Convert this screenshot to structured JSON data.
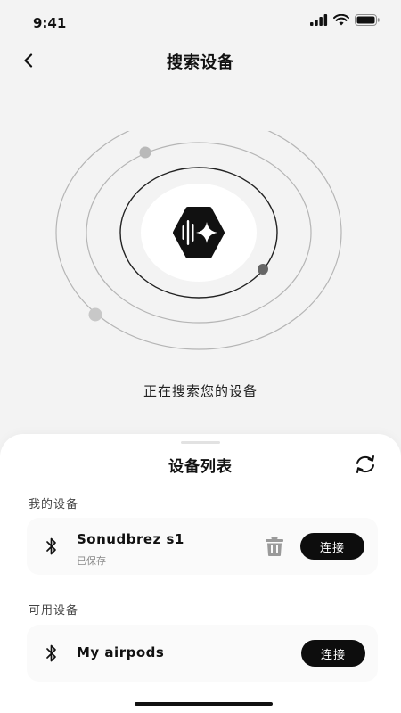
{
  "status_bar": {
    "time": "9:41"
  },
  "nav": {
    "title": "搜索设备",
    "back_icon": "chevron-left-icon"
  },
  "search": {
    "status_text": "正在搜索您的设备",
    "center_icon": "sound-wave-sparkle-icon"
  },
  "sheet": {
    "title": "设备列表",
    "refresh_icon": "refresh-icon",
    "my_devices": {
      "label": "我的设备",
      "items": [
        {
          "name": "Sonudbrez s1",
          "status": "已保存",
          "connect_label": "连接",
          "icon": "bluetooth-icon",
          "action_icon": "trash-icon"
        }
      ]
    },
    "available_devices": {
      "label": "可用设备",
      "items": [
        {
          "name": "My airpods",
          "connect_label": "连接",
          "icon": "bluetooth-icon"
        }
      ]
    }
  },
  "colors": {
    "background": "#f3f3f3",
    "sheet": "#ffffff",
    "card": "#fafafa",
    "button": "#0d0d0d",
    "ring": "#b5b5b5",
    "ring_inner": "#222222"
  }
}
